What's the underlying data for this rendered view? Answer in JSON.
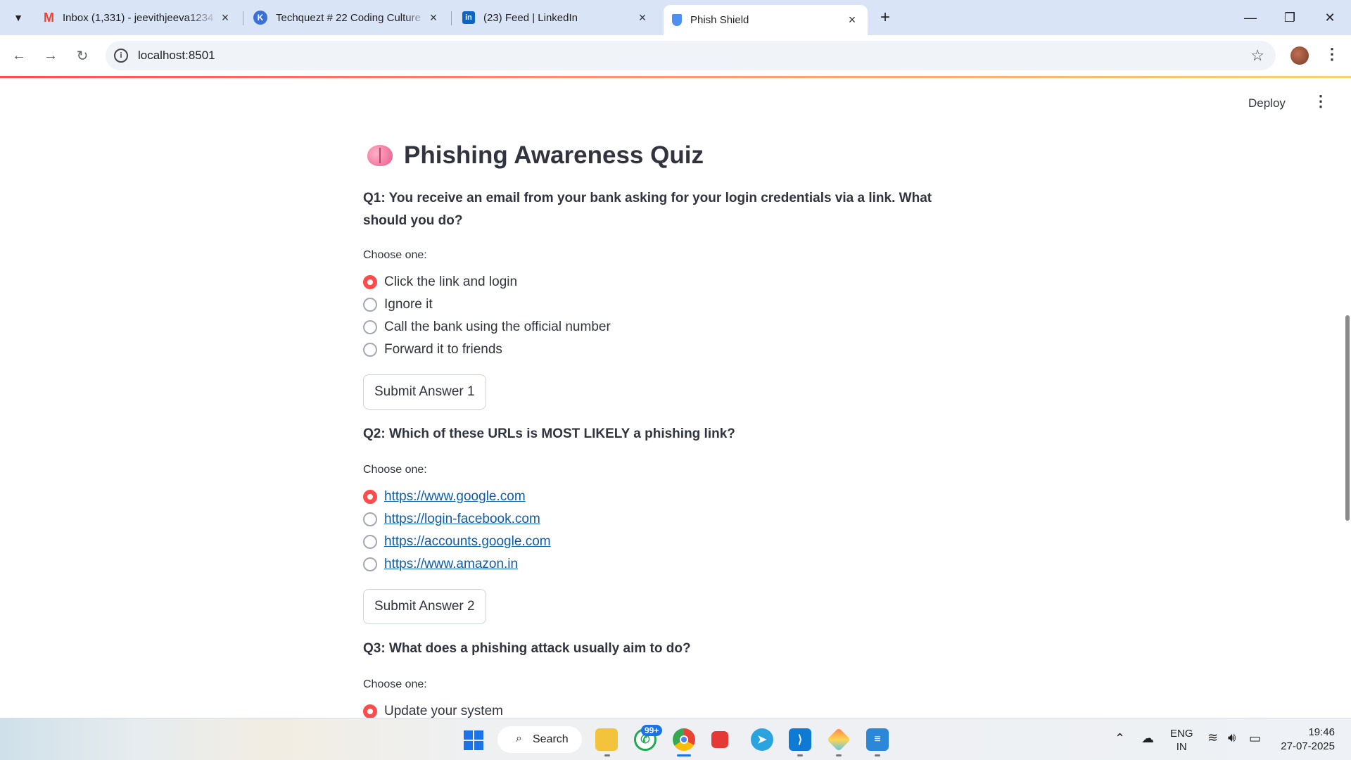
{
  "browser": {
    "tabs": [
      {
        "title": "Inbox (1,331) - jeevithjeeva1234",
        "icon": "gmail-icon"
      },
      {
        "title": "Techquezt # 22 Coding Culture",
        "icon": "k-logo-icon"
      },
      {
        "title": "(23) Feed | LinkedIn",
        "icon": "linkedin-icon"
      },
      {
        "title": "Phish Shield",
        "icon": "shield-icon",
        "active": true
      }
    ],
    "url": "localhost:8501"
  },
  "app": {
    "deploy_label": "Deploy",
    "title": "Phishing Awareness Quiz",
    "questions": [
      {
        "text": "Q1: You receive an email from your bank asking for your login credentials via a link. What should you do?",
        "choose_label": "Choose one:",
        "options": [
          "Click the link and login",
          "Ignore it",
          "Call the bank using the official number",
          "Forward it to friends"
        ],
        "selected": 0,
        "submit_label": "Submit Answer 1"
      },
      {
        "text": "Q2: Which of these URLs is MOST LIKELY a phishing link?",
        "choose_label": "Choose one:",
        "options": [
          "https://www.google.com",
          "https://login-facebook.com",
          "https://accounts.google.com",
          "https://www.amazon.in"
        ],
        "selected": 0,
        "submit_label": "Submit Answer 2"
      },
      {
        "text": "Q3: What does a phishing attack usually aim to do?",
        "choose_label": "Choose one:",
        "options": [
          "Update your system"
        ],
        "selected": 0
      }
    ]
  },
  "taskbar": {
    "search_label": "Search",
    "whatsapp_badge": "99+",
    "lang_line1": "ENG",
    "lang_line2": "IN",
    "time": "19:46",
    "date": "27-07-2025"
  },
  "colors": {
    "accent": "#ff4b4b",
    "link": "#0b5cad",
    "tabstrip": "#d9e4f7"
  }
}
